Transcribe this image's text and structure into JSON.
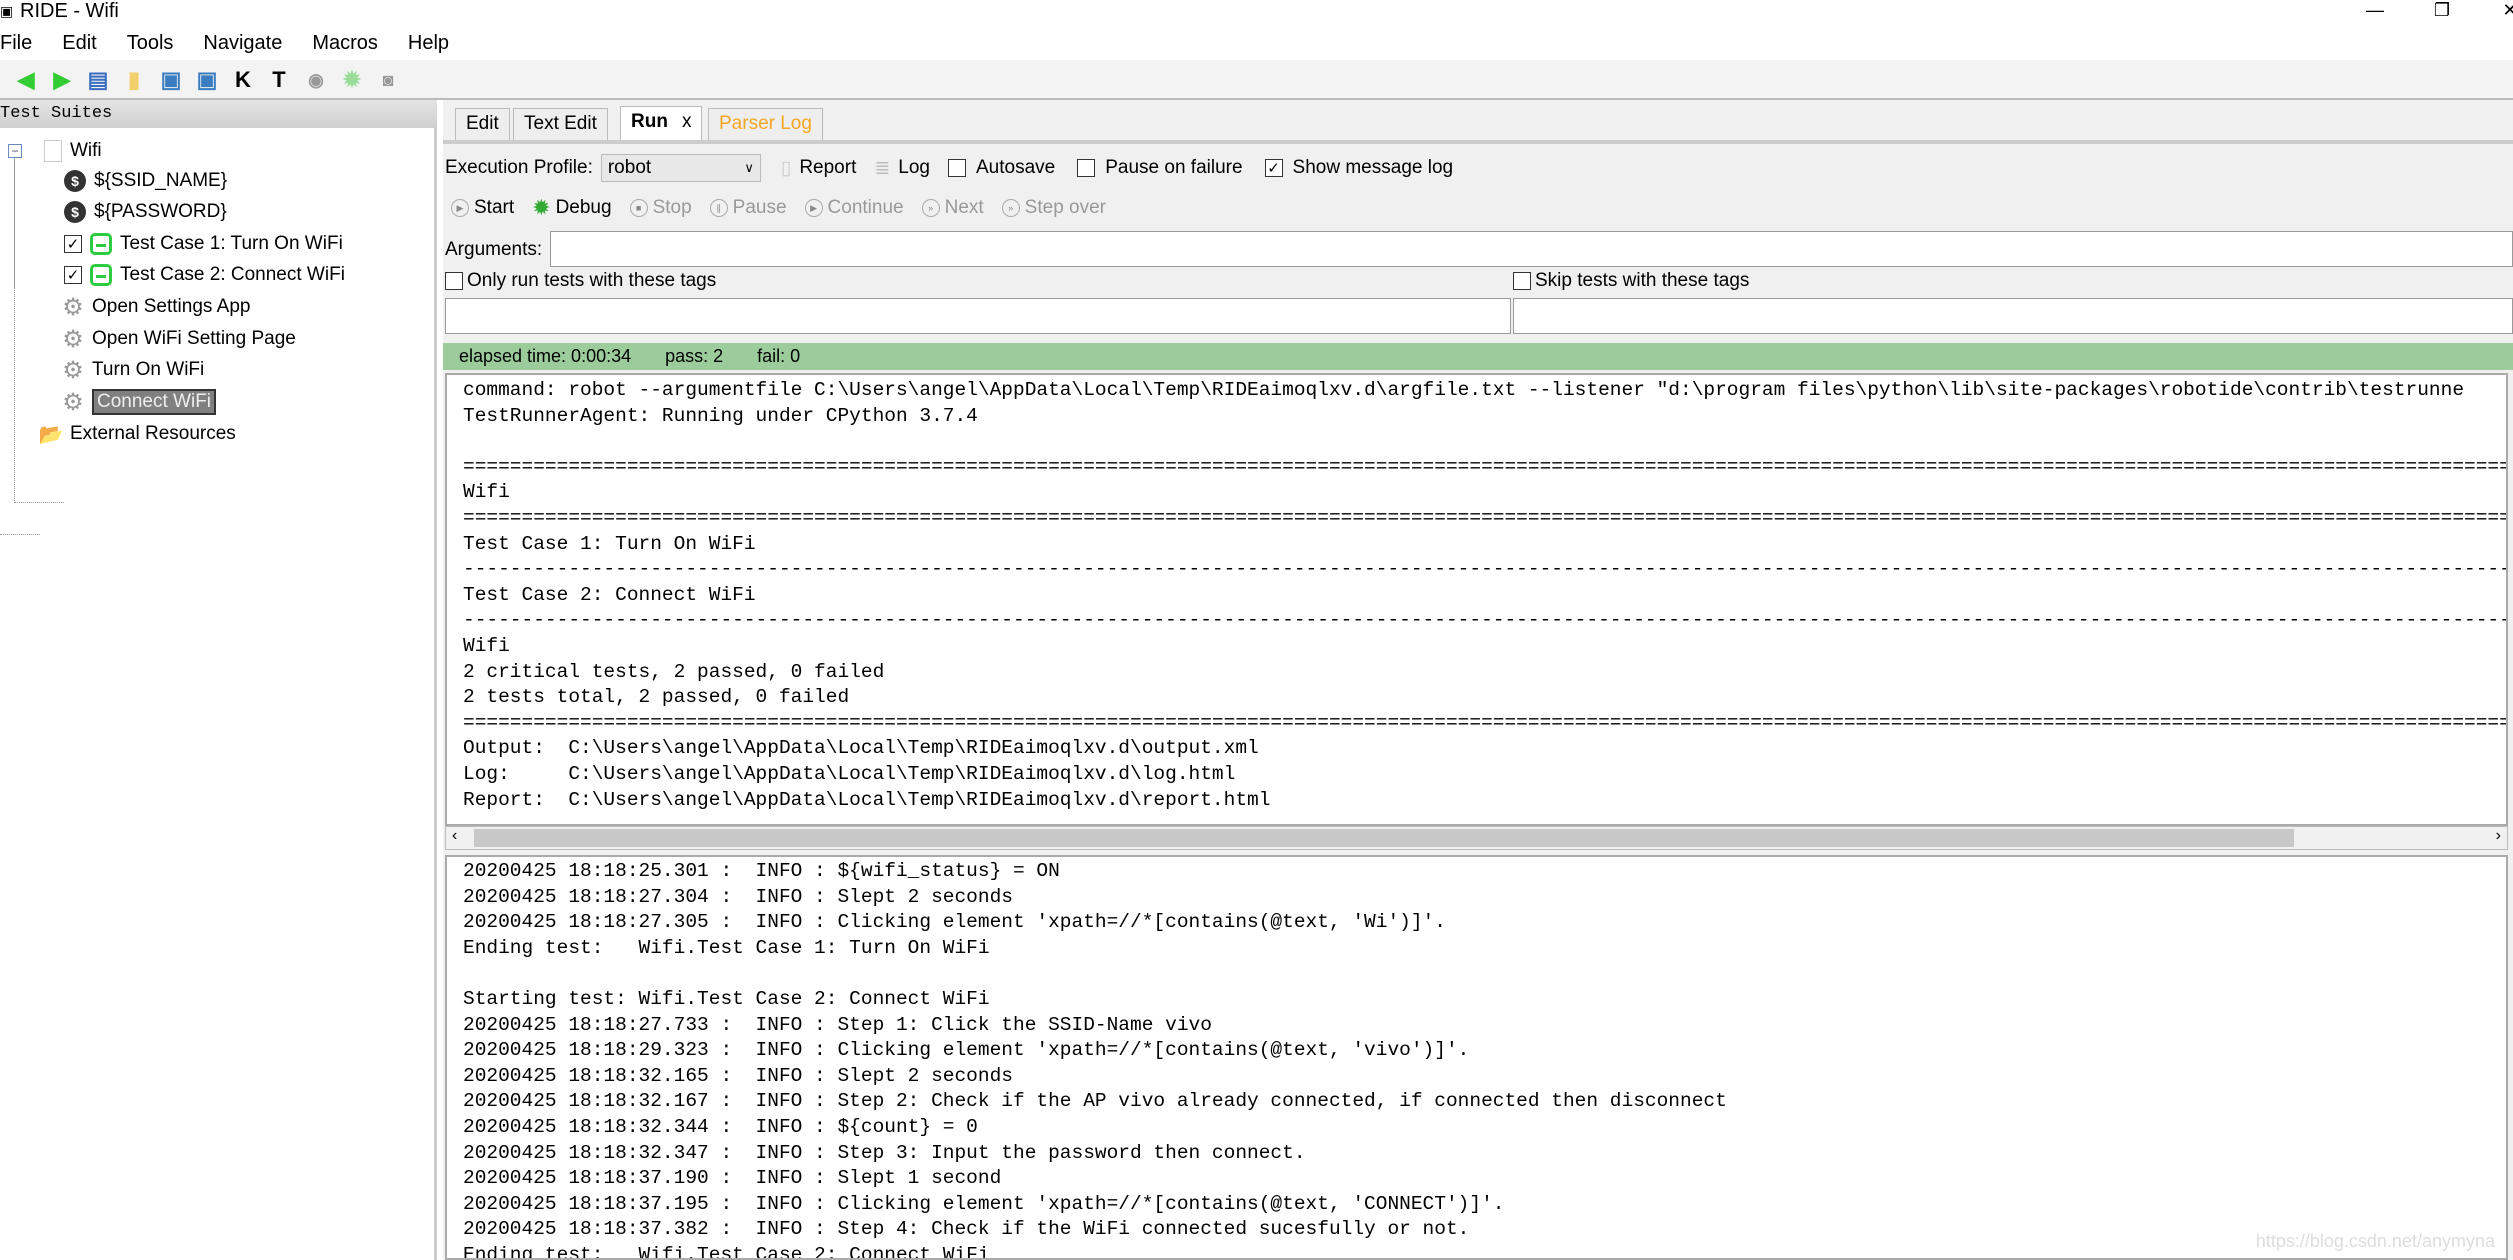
{
  "window": {
    "title": "RIDE - Wifi",
    "minimize": "—",
    "restore": "❐",
    "close": "✕"
  },
  "menu": [
    "File",
    "Edit",
    "Tools",
    "Navigate",
    "Macros",
    "Help"
  ],
  "toolbar": {
    "icons": [
      "arrow-left-icon",
      "arrow-right-icon",
      "open-icon",
      "folder-icon",
      "save-icon",
      "save-all-icon",
      "search-keywords-icon",
      "search-tests-icon",
      "run-icon",
      "debug-icon",
      "stop-icon"
    ],
    "k": "K",
    "t": "T"
  },
  "sidebar": {
    "header": "Test Suites",
    "items": [
      "Wifi",
      "${SSID_NAME}",
      "${PASSWORD}",
      "Test Case 1: Turn On WiFi",
      "Test Case 2: Connect WiFi",
      "Open Settings App",
      "Open WiFi Setting Page",
      "Turn On WiFi",
      "Connect WiFi",
      "External Resources"
    ],
    "selected": "Connect WiFi"
  },
  "tabs": {
    "edit": "Edit",
    "text_edit": "Text Edit",
    "run": "Run",
    "close": "x",
    "parser_log": "Parser Log",
    "active": "Run",
    "parser_color": "#f5a623"
  },
  "run": {
    "profile_label": "Execution Profile:",
    "profile_value": "robot",
    "report": "Report",
    "log": "Log",
    "autosave": "Autosave",
    "autosave_checked": false,
    "pause_on_failure": "Pause on failure",
    "pause_checked": false,
    "show_message_log": "Show message log",
    "show_checked": true,
    "start": "Start",
    "debug": "Debug",
    "stop": "Stop",
    "pause": "Pause",
    "continue": "Continue",
    "next": "Next",
    "step_over": "Step over",
    "arguments_label": "Arguments:",
    "arguments_value": "",
    "only_run_tags": "Only run tests with these tags",
    "skip_tags": "Skip tests with these tags"
  },
  "status": {
    "elapsed": "elapsed time: 0:00:34",
    "pass": "pass: 2",
    "fail": "fail: 0",
    "color": "#9ccc9c"
  },
  "output": [
    "command: robot --argumentfile C:\\Users\\angel\\AppData\\Local\\Temp\\RIDEaimoqlxv.d\\argfile.txt --listener \"d:\\program files\\python\\lib\\site-packages\\robotide\\contrib\\testrunne",
    "TestRunnerAgent: Running under CPython 3.7.4",
    "",
    "==============================================================================================================================================================================================",
    "Wifi",
    "==============================================================================================================================================================================================",
    "Test Case 1: Turn On WiFi",
    "----------------------------------------------------------------------------------------------------------------------------------------------------------------------------------------------",
    "Test Case 2: Connect WiFi",
    "----------------------------------------------------------------------------------------------------------------------------------------------------------------------------------------------",
    "Wifi",
    "2 critical tests, 2 passed, 0 failed",
    "2 tests total, 2 passed, 0 failed",
    "==============================================================================================================================================================================================",
    "Output:  C:\\Users\\angel\\AppData\\Local\\Temp\\RIDEaimoqlxv.d\\output.xml",
    "Log:     C:\\Users\\angel\\AppData\\Local\\Temp\\RIDEaimoqlxv.d\\log.html",
    "Report:  C:\\Users\\angel\\AppData\\Local\\Temp\\RIDEaimoqlxv.d\\report.html"
  ],
  "message_log": [
    "20200425 18:18:25.301 :  INFO : ${wifi_status} = ON",
    "20200425 18:18:27.304 :  INFO : Slept 2 seconds",
    "20200425 18:18:27.305 :  INFO : Clicking element 'xpath=//*[contains(@text, 'Wi')]'.",
    "Ending test:   Wifi.Test Case 1: Turn On WiFi",
    "",
    "Starting test: Wifi.Test Case 2: Connect WiFi",
    "20200425 18:18:27.733 :  INFO : Step 1: Click the SSID-Name vivo",
    "20200425 18:18:29.323 :  INFO : Clicking element 'xpath=//*[contains(@text, 'vivo')]'.",
    "20200425 18:18:32.165 :  INFO : Slept 2 seconds",
    "20200425 18:18:32.167 :  INFO : Step 2: Check if the AP vivo already connected, if connected then disconnect",
    "20200425 18:18:32.344 :  INFO : ${count} = 0",
    "20200425 18:18:32.347 :  INFO : Step 3: Input the password then connect.",
    "20200425 18:18:37.190 :  INFO : Slept 1 second",
    "20200425 18:18:37.195 :  INFO : Clicking element 'xpath=//*[contains(@text, 'CONNECT')]'.",
    "20200425 18:18:37.382 :  INFO : Step 4: Check if the WiFi connected sucesfully or not.",
    "Ending test:   Wifi.Test Case 2: Connect WiFi"
  ],
  "watermark": "https://blog.csdn.net/anymyna"
}
